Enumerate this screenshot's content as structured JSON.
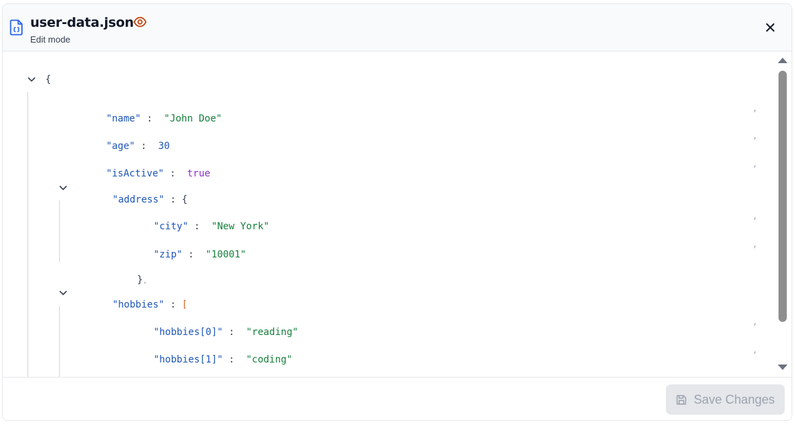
{
  "header": {
    "title": "user-data.json",
    "subtitle": "Edit mode",
    "icons": {
      "file": "file-json-icon",
      "preview": "eye-icon",
      "close": "close-icon"
    },
    "accent_color": "#2563eb",
    "eye_color": "#c2410c"
  },
  "editor": {
    "root_open": "{",
    "fields": {
      "name": {
        "key": "\"name\"",
        "sep": ":",
        "value": "\"John Doe\""
      },
      "age": {
        "key": "\"age\"",
        "sep": ":",
        "value": "30"
      },
      "isActive": {
        "key": "\"isActive\"",
        "sep": ":",
        "value": "true"
      },
      "address": {
        "key": "\"address\"",
        "sep": ":",
        "open": "{",
        "close": "}",
        "city": {
          "key": "\"city\"",
          "sep": ":",
          "value": "\"New York\""
        },
        "zip": {
          "key": "\"zip\"",
          "sep": ":",
          "value": "\"10001\""
        }
      },
      "hobbies": {
        "key": "\"hobbies\"",
        "sep": ":",
        "open": "[",
        "close": "]",
        "item0": {
          "key": "\"hobbies[0]\"",
          "sep": ":",
          "value": "\"reading\""
        },
        "item1": {
          "key": "\"hobbies[1]\"",
          "sep": ":",
          "value": "\"coding\""
        }
      }
    },
    "comma": ","
  },
  "footer": {
    "save_label": "Save Changes",
    "save_icon": "save-icon",
    "save_disabled": true
  }
}
